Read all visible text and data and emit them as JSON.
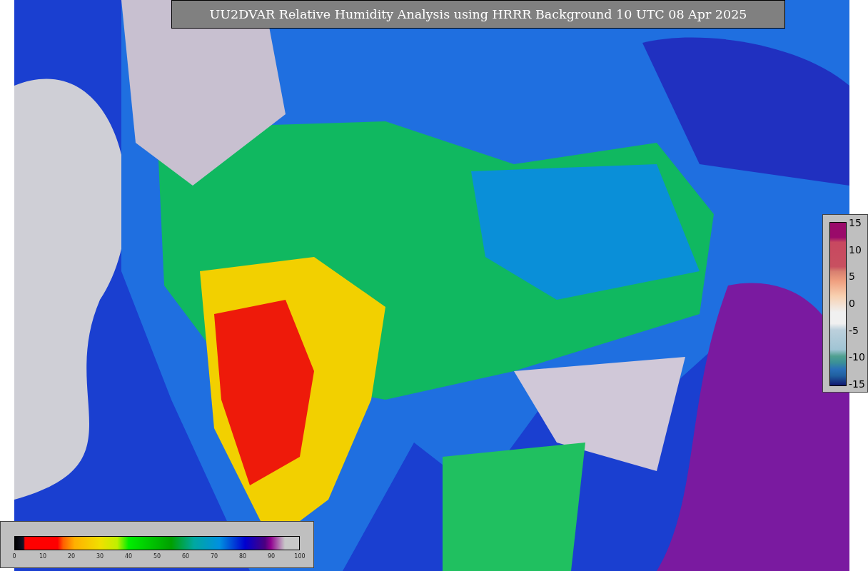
{
  "title": "UU2DVAR Relative Humidity Analysis using HRRR Background 10 UTC 08 Apr 2025",
  "difference_legend": {
    "ticks": [
      "15",
      "10",
      "5",
      "0",
      "-5",
      "-10",
      "-15"
    ]
  },
  "humidity_legend": {
    "ticks": [
      "0",
      "10",
      "20",
      "30",
      "40",
      "50",
      "60",
      "70",
      "80",
      "90",
      "100"
    ]
  }
}
